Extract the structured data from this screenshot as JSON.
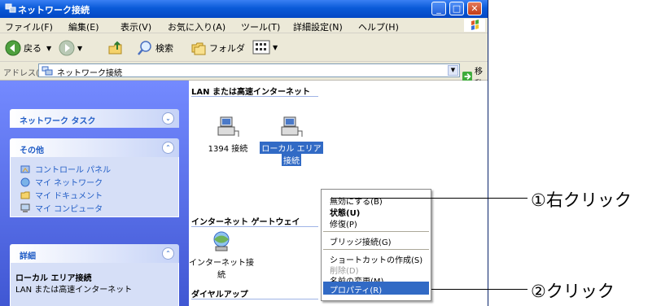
{
  "window": {
    "title": "ネットワーク接続"
  },
  "menubar": {
    "items": [
      "ファイル(F)",
      "編集(E)",
      "表示(V)",
      "お気に入り(A)",
      "ツール(T)",
      "詳細設定(N)",
      "ヘルプ(H)"
    ]
  },
  "toolbar": {
    "back": "戻る",
    "search": "検索",
    "folders": "フォルダ"
  },
  "addressbar": {
    "label": "アドレス(D)",
    "value": "ネットワーク接続",
    "go": "移動"
  },
  "left_panel": {
    "network_tasks": {
      "title": "ネットワーク タスク"
    },
    "other": {
      "title": "その他",
      "links": [
        "コントロール パネル",
        "マイ ネットワーク",
        "マイ ドキュメント",
        "マイ コンピュータ"
      ]
    },
    "details": {
      "title": "詳細",
      "name": "ローカル エリア接続",
      "desc": "LAN または高速インターネット"
    }
  },
  "content": {
    "group_lan": "LAN または高速インターネット",
    "conn_1394": "1394 接続",
    "conn_local_line1": "ローカル エリア",
    "conn_local_line2": "接続",
    "group_gateway": "インターネット ゲートウェイ",
    "conn_gateway_line1": "インターネット接",
    "conn_gateway_line2": "続",
    "group_dialup": "ダイヤルアップ"
  },
  "context_menu": {
    "items": [
      {
        "label": "無効にする(B)",
        "style": "normal"
      },
      {
        "label": "状態(U)",
        "style": "bold"
      },
      {
        "label": "修復(P)",
        "style": "normal"
      },
      {
        "label": "ブリッジ接続(G)",
        "style": "normal"
      },
      {
        "label": "ショートカットの作成(S)",
        "style": "normal"
      },
      {
        "label": "削除(D)",
        "style": "disabled"
      },
      {
        "label": "名前の変更(M)",
        "style": "normal"
      },
      {
        "label": "プロパティ(R)",
        "style": "highlighted"
      }
    ]
  },
  "annotations": {
    "right_click": "①右クリック",
    "click": "②クリック"
  },
  "colors": {
    "titlebar": "#0a5ad8",
    "selection": "#316ac5",
    "link": "#215dc6"
  }
}
